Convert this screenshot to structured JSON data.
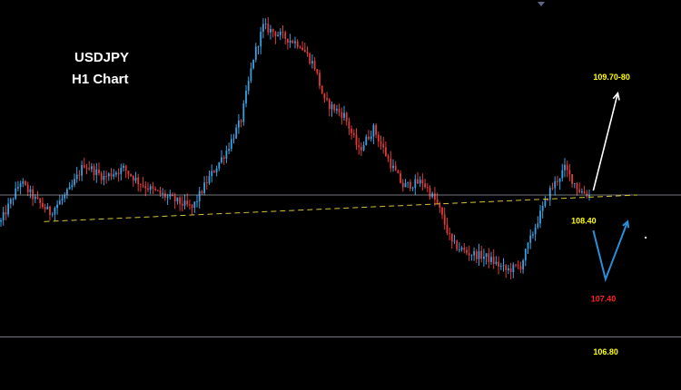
{
  "chart_data": {
    "type": "candlestick",
    "title": "USDJPY",
    "subtitle": "H1 Chart",
    "ylim": [
      106.2,
      110.6
    ],
    "x_count": 300,
    "colors": {
      "background": "#000000",
      "bull": "#3aa0e0",
      "bear": "#e23a3a",
      "trendline": "#d4c23a",
      "horizontal": "#b8bcc8",
      "up_arrow": "#ffffff",
      "zigzag": "#2a8fd8",
      "label_yellow": "#ffff00",
      "label_red": "#ff2020"
    },
    "price_path": [
      [
        0,
        108.1
      ],
      [
        8,
        108.55
      ],
      [
        14,
        108.35
      ],
      [
        20,
        108.2
      ],
      [
        28,
        108.45
      ],
      [
        34,
        108.75
      ],
      [
        42,
        108.6
      ],
      [
        50,
        108.7
      ],
      [
        56,
        108.55
      ],
      [
        62,
        108.45
      ],
      [
        70,
        108.35
      ],
      [
        78,
        108.25
      ],
      [
        84,
        108.55
      ],
      [
        92,
        108.9
      ],
      [
        98,
        109.25
      ],
      [
        103,
        109.95
      ],
      [
        107,
        110.3
      ],
      [
        114,
        110.2
      ],
      [
        122,
        110.1
      ],
      [
        128,
        109.85
      ],
      [
        132,
        109.45
      ],
      [
        140,
        109.3
      ],
      [
        146,
        108.9
      ],
      [
        152,
        109.15
      ],
      [
        158,
        108.8
      ],
      [
        164,
        108.5
      ],
      [
        172,
        108.55
      ],
      [
        178,
        108.3
      ],
      [
        184,
        107.85
      ],
      [
        190,
        107.75
      ],
      [
        198,
        107.7
      ],
      [
        206,
        107.55
      ],
      [
        212,
        107.6
      ],
      [
        218,
        108.05
      ],
      [
        224,
        108.45
      ],
      [
        230,
        108.7
      ],
      [
        236,
        108.45
      ],
      [
        240,
        108.4
      ]
    ],
    "horizontal_levels": [
      108.4,
      106.8
    ],
    "trendline": {
      "from": [
        18,
        108.1
      ],
      "to": [
        260,
        108.4
      ]
    },
    "up_arrow": {
      "from": [
        242,
        108.45
      ],
      "to": [
        252,
        109.55
      ]
    },
    "zigzag": [
      [
        242,
        108.0
      ],
      [
        247,
        107.45
      ],
      [
        256,
        108.1
      ]
    ],
    "marker": [
      263,
      107.93
    ],
    "labels": [
      {
        "text": "109.70-80",
        "x": 242,
        "y": 109.7,
        "color": "yellow"
      },
      {
        "text": "108.40",
        "x": 233,
        "y": 108.08,
        "color": "yellow"
      },
      {
        "text": "107.40",
        "x": 241,
        "y": 107.2,
        "color": "red"
      },
      {
        "text": "106.80",
        "x": 242,
        "y": 106.6,
        "color": "yellow"
      }
    ]
  }
}
